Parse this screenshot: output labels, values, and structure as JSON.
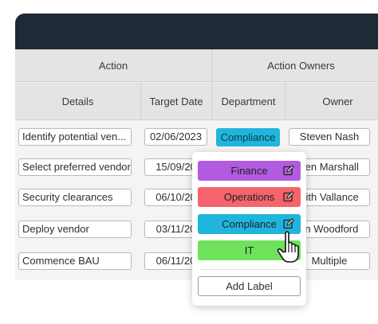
{
  "table": {
    "group_headers": {
      "action": "Action",
      "owners": "Action Owners"
    },
    "sub_headers": {
      "details": "Details",
      "target_date": "Target Date",
      "department": "Department",
      "owner": "Owner"
    },
    "rows": [
      {
        "details": "Identify potential ven...",
        "date": "02/06/2023",
        "department": "Compliance",
        "owner": "Steven Nash"
      },
      {
        "details": "Select preferred vendor",
        "date": "15/09/20",
        "owner": "ven Marshall"
      },
      {
        "details": "Security clearances",
        "date": "06/10/20",
        "owner": "eith Vallance"
      },
      {
        "details": "Deploy vendor",
        "date": "03/11/20",
        "owner": "lin Woodford"
      },
      {
        "details": "Commence BAU",
        "date": "06/11/20",
        "owner": "Multiple"
      }
    ]
  },
  "dropdown": {
    "options": [
      {
        "label": "Finance",
        "color": "#b15be0"
      },
      {
        "label": "Operations",
        "color": "#f4646c"
      },
      {
        "label": "Compliance",
        "color": "#1fb5dd"
      },
      {
        "label": "IT",
        "color": "#6fe25b"
      }
    ],
    "add_label": "Add Label"
  },
  "colors": {
    "topbar": "#1e2a35",
    "header_bg": "#e4e4e4"
  }
}
